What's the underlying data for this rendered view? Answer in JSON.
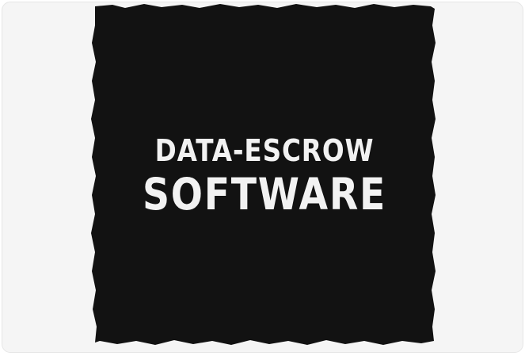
{
  "logo": {
    "line1": "DATA-ESCROW",
    "line2": "SOFTWARE"
  },
  "colors": {
    "page_background": "#f5f5f5",
    "block": "#121212",
    "text": "#f2f2f2"
  }
}
